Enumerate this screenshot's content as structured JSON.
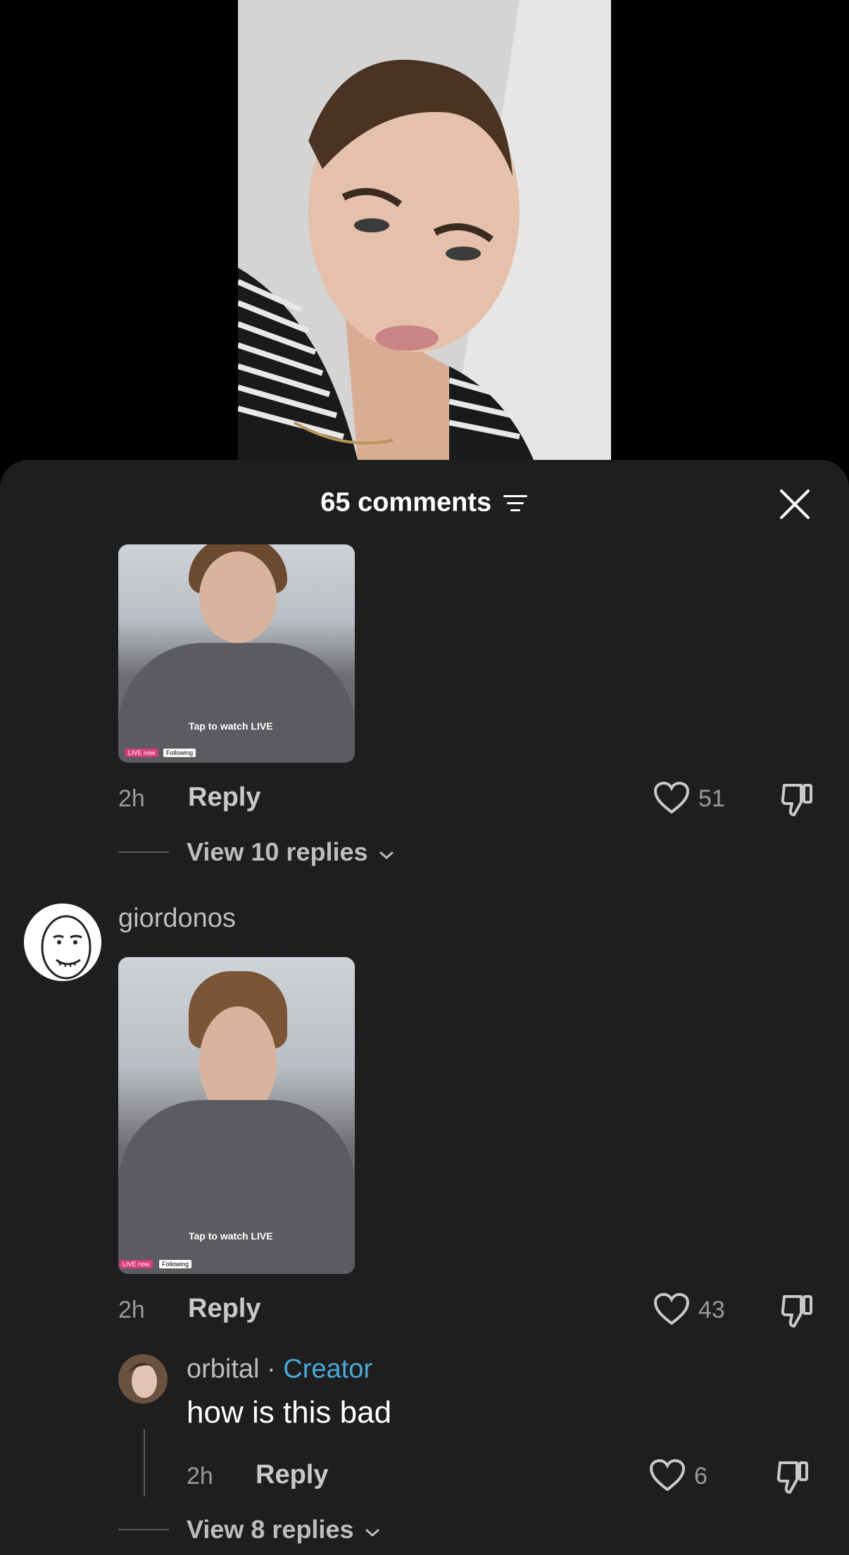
{
  "header": {
    "title": "65 comments"
  },
  "comments": [
    {
      "time": "2h",
      "reply_label": "Reply",
      "likes": "51",
      "view_replies": "View 10 replies",
      "thumb": {
        "overlay_text": "Tap to watch LIVE",
        "live_badge": "LIVE now",
        "following_badge": "Following"
      }
    },
    {
      "username": "giordonos",
      "time": "2h",
      "reply_label": "Reply",
      "likes": "43",
      "thumb": {
        "overlay_text": "Tap to watch LIVE",
        "live_badge": "LIVE now",
        "following_badge": "Following"
      }
    }
  ],
  "reply": {
    "username": "orbital",
    "separator": " · ",
    "role": "Creator",
    "text": "how is this bad",
    "time": "2h",
    "reply_label": "Reply",
    "likes": "6"
  },
  "footer": {
    "view_replies": "View 8 replies"
  },
  "colors": {
    "sheet_bg": "#1e1e1e",
    "creator_accent": "#4aa8d8"
  }
}
